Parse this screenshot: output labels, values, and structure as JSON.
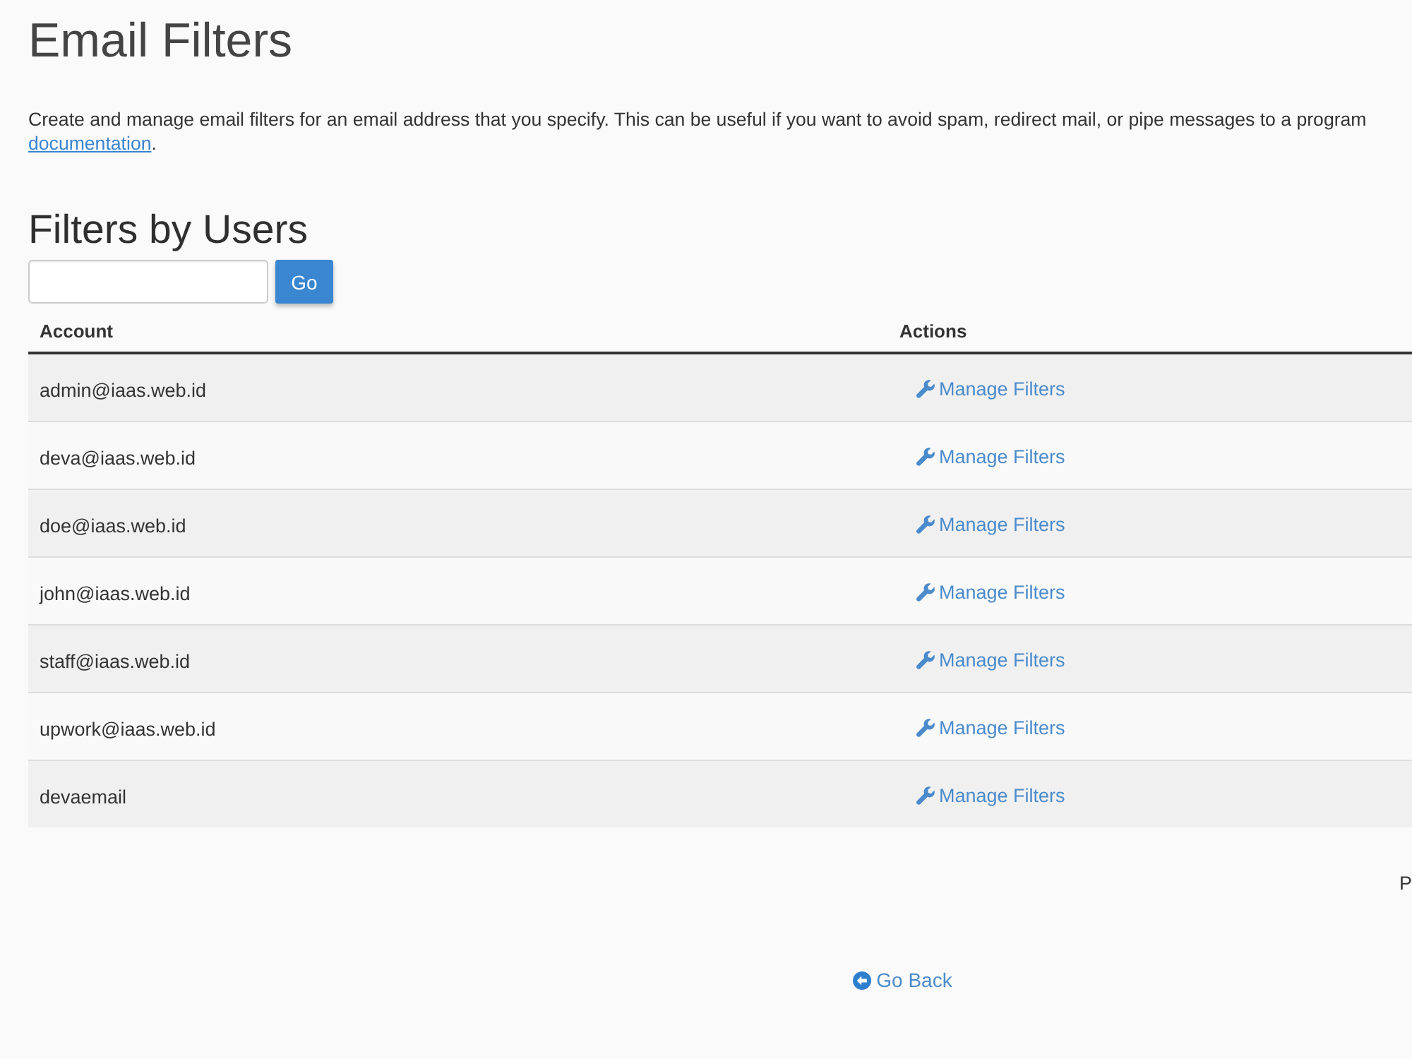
{
  "page": {
    "title": "Email Filters",
    "description": {
      "text": "Create and manage email filters for an email address that you specify. This can be useful if you want to avoid spam, redirect mail, or pipe messages to a program",
      "link": "documentation",
      "tail": "."
    }
  },
  "section": {
    "heading": "Filters by Users",
    "search": {
      "button": "Go"
    }
  },
  "table": {
    "columns": [
      "Account",
      "Actions"
    ],
    "rows": [
      {
        "account": "admin@iaas.web.id",
        "action": "Manage Filters"
      },
      {
        "account": "deva@iaas.web.id",
        "action": "Manage Filters"
      },
      {
        "account": "doe@iaas.web.id",
        "action": "Manage Filters"
      },
      {
        "account": "john@iaas.web.id",
        "action": "Manage Filters"
      },
      {
        "account": "staff@iaas.web.id",
        "action": "Manage Filters"
      },
      {
        "account": "upwork@iaas.web.id",
        "action": "Manage Filters"
      },
      {
        "account": "devaemail",
        "action": "Manage Filters"
      }
    ]
  },
  "table_footer": {
    "text": "P"
  },
  "back_link": {
    "label": "Go Back"
  }
}
